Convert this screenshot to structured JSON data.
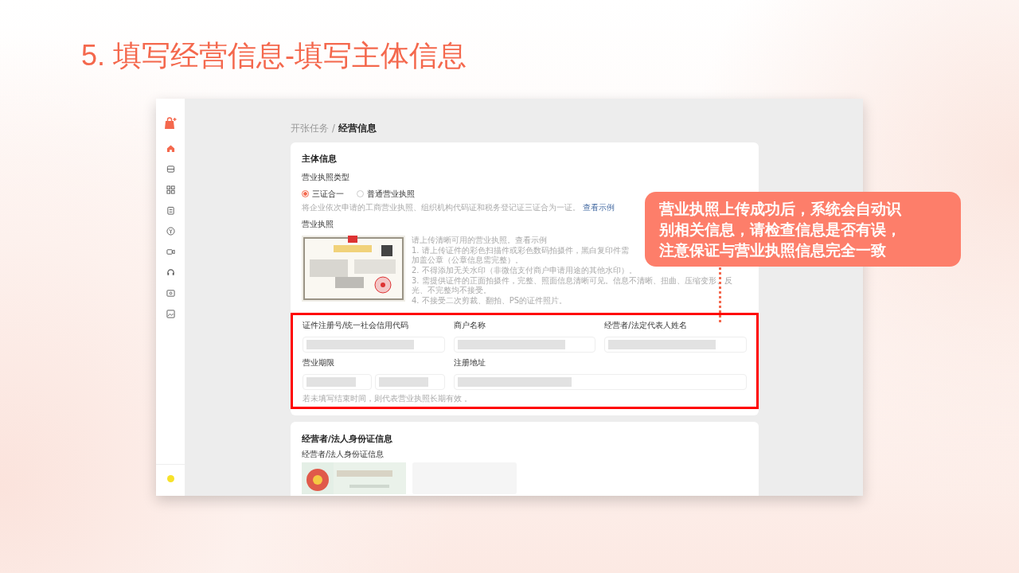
{
  "slide": {
    "title": "5. 填写经营信息-填写主体信息"
  },
  "sidebar": {
    "items": [
      {
        "selected": true
      },
      {
        "selected": false
      },
      {
        "selected": false
      },
      {
        "selected": false
      },
      {
        "selected": false
      },
      {
        "selected": false
      },
      {
        "selected": false
      },
      {
        "selected": false
      },
      {
        "selected": false
      }
    ]
  },
  "breadcrumb": {
    "parent": "开张任务",
    "separator": "/",
    "current": "经营信息"
  },
  "subject_card": {
    "title": "主体信息",
    "license_type": {
      "label": "营业执照类型",
      "options": [
        {
          "label": "三证合一",
          "selected": true
        },
        {
          "label": "普通营业执照",
          "selected": false
        }
      ],
      "hint": "将企业依次申请的工商营业执照、组织机构代码证和税务登记证三证合为一证。",
      "hint_link": "查看示例"
    },
    "license": {
      "label": "营业执照",
      "guidance": [
        "请上传清晰可用的营业执照。查看示例",
        "1. 请上传证件的彩色扫描件或彩色数码拍摄件，黑白复印件需加盖公章（公章信息需完整）。",
        "2. 不得添加无关水印（非微信支付商户申请用途的其他水印）。",
        "3. 需提供证件的正面拍摄件，完整、照面信息清晰可见。信息不清晰、扭曲、压缩变形、反光、不完整均不接受。",
        "4. 不接受二次剪裁、翻拍、PS的证件照片。"
      ]
    },
    "fields": [
      {
        "label": "证件注册号/统一社会信用代码",
        "kind": "single"
      },
      {
        "label": "商户名称",
        "kind": "single"
      },
      {
        "label": "经营者/法定代表人姓名",
        "kind": "single"
      },
      {
        "label": "营业期限",
        "kind": "range"
      },
      {
        "label": "注册地址",
        "kind": "wide"
      }
    ],
    "fields_hint": "若未填写结束时间，则代表营业执照长期有效 。"
  },
  "id_card": {
    "title": "经营者/法人身份证信息",
    "label": "经营者/法人身份证信息"
  },
  "callout": {
    "text": "营业执照上传成功后，系统会自动识别相关信息，请检查信息是否有误，注意保证与营业执照信息完全一致"
  }
}
